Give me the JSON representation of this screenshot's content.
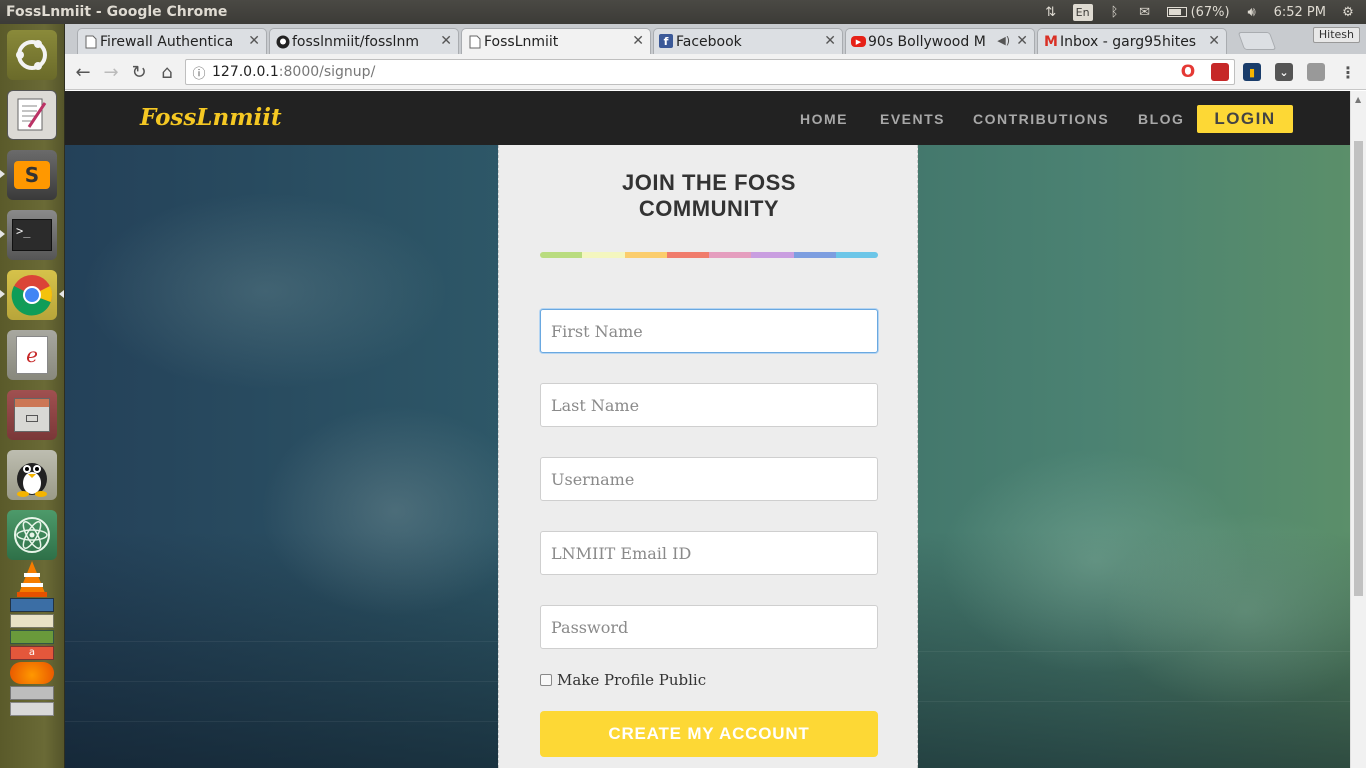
{
  "os": {
    "window_title": "FossLnmiit - Google Chrome",
    "keyboard_lang": "En",
    "battery": "(67%)",
    "clock": "6:52 PM"
  },
  "browser": {
    "profile_name": "Hitesh",
    "tabs": [
      {
        "label": "Firewall Authentica",
        "favicon": "doc-icon",
        "active": false
      },
      {
        "label": "fosslnmiit/fosslnm",
        "favicon": "github-icon",
        "active": false
      },
      {
        "label": "FossLnmiit",
        "favicon": "doc-icon",
        "active": true
      },
      {
        "label": "Facebook",
        "favicon": "facebook-icon",
        "active": false
      },
      {
        "label": "90s Bollywood M",
        "favicon": "youtube-icon",
        "active": false
      },
      {
        "label": "Inbox - garg95hites",
        "favicon": "gmail-icon",
        "active": false
      }
    ],
    "url_host": "127.0.0.1",
    "url_rest": ":8000/signup/"
  },
  "site": {
    "brand": "FossLnmiit",
    "nav": {
      "home": "HOME",
      "events": "EVENTS",
      "contributions": "CONTRIBUTIONS",
      "blog": "BLOG",
      "login": "LOGIN"
    },
    "accent": "#fdd835"
  },
  "signup": {
    "title_line1": "JOIN THE FOSS",
    "title_line2": "COMMUNITY",
    "color_bar": [
      "#b9dc7f",
      "#f4f6bf",
      "#fbcd6d",
      "#f07c6c",
      "#e59ebf",
      "#c99ee0",
      "#7d9ee0",
      "#6cc6e8"
    ],
    "fields": {
      "first_name": {
        "placeholder": "First Name",
        "value": ""
      },
      "last_name": {
        "placeholder": "Last Name",
        "value": ""
      },
      "username": {
        "placeholder": "Username",
        "value": ""
      },
      "email": {
        "placeholder": "LNMIIT Email ID",
        "value": ""
      },
      "password": {
        "placeholder": "Password",
        "value": ""
      }
    },
    "public_label": "Make Profile Public",
    "public_checked": false,
    "submit": "CREATE MY ACCOUNT"
  }
}
